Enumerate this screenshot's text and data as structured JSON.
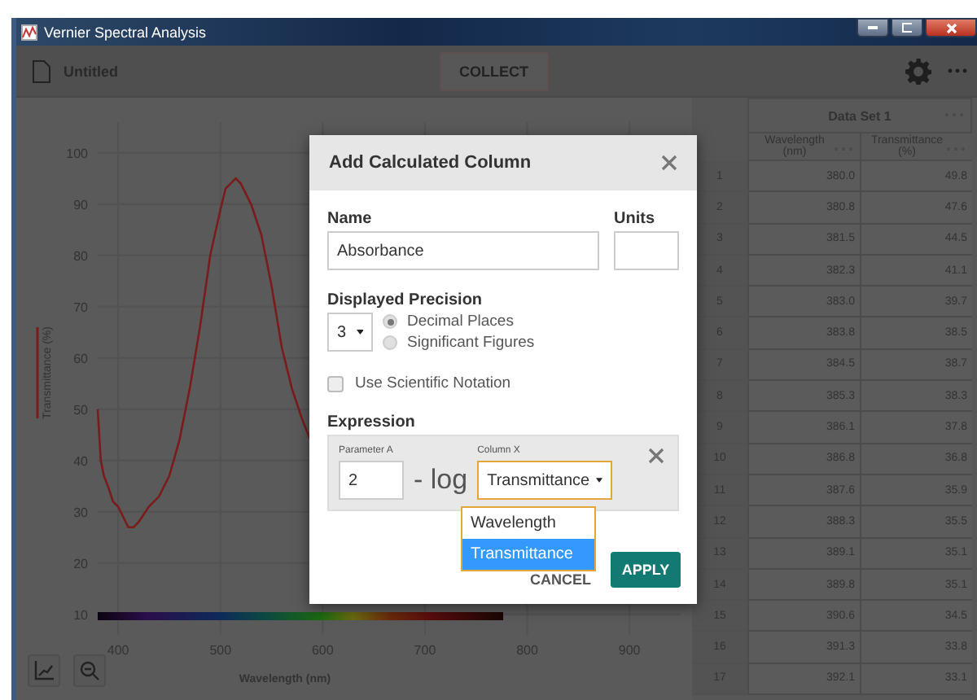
{
  "window": {
    "title": "Vernier Spectral Analysis"
  },
  "toolbar": {
    "document": "Untitled",
    "collect_button": {
      "label": "COLLECT",
      "disabled": true
    }
  },
  "graph": {
    "chart_data": {
      "type": "line",
      "xlabel": "Wavelength (nm)",
      "ylabel": "Transmittance (%)",
      "xlim": [
        380,
        950
      ],
      "ylim": [
        6,
        106
      ],
      "xticks": [
        400,
        500,
        600,
        700,
        800,
        900
      ],
      "yticks": [
        10,
        20,
        30,
        40,
        50,
        60,
        70,
        80,
        90,
        100
      ],
      "grid": true,
      "x": [
        380,
        383,
        386,
        390,
        395,
        400,
        405,
        410,
        415,
        420,
        430,
        440,
        450,
        460,
        470,
        480,
        490,
        500,
        505,
        510,
        515,
        520,
        530,
        540,
        550,
        560,
        570,
        580,
        590
      ],
      "series": [
        {
          "color": "#7a1c1c",
          "values": [
            50,
            40,
            37,
            35,
            32,
            31,
            29,
            27,
            27,
            28,
            31,
            33,
            37,
            44,
            54,
            66,
            80,
            89,
            93,
            94,
            95,
            94,
            90,
            84,
            74,
            62,
            54,
            48,
            43
          ]
        }
      ]
    }
  },
  "table": {
    "group": "Data Set 1",
    "columns": [
      "Wavelength (nm)",
      "Transmittance (%)"
    ],
    "rows": [
      {
        "index": "1",
        "cells": [
          "380.0",
          "49.8"
        ]
      },
      {
        "index": "2",
        "cells": [
          "380.8",
          "47.6"
        ]
      },
      {
        "index": "3",
        "cells": [
          "381.5",
          "44.5"
        ]
      },
      {
        "index": "4",
        "cells": [
          "382.3",
          "41.1"
        ]
      },
      {
        "index": "5",
        "cells": [
          "383.0",
          "39.7"
        ]
      },
      {
        "index": "6",
        "cells": [
          "383.8",
          "38.5"
        ]
      },
      {
        "index": "7",
        "cells": [
          "384.5",
          "38.7"
        ]
      },
      {
        "index": "8",
        "cells": [
          "385.3",
          "38.3"
        ]
      },
      {
        "index": "9",
        "cells": [
          "386.1",
          "37.8"
        ]
      },
      {
        "index": "10",
        "cells": [
          "386.8",
          "36.8"
        ]
      },
      {
        "index": "11",
        "cells": [
          "387.6",
          "35.9"
        ]
      },
      {
        "index": "12",
        "cells": [
          "388.3",
          "35.5"
        ]
      },
      {
        "index": "13",
        "cells": [
          "389.1",
          "35.1"
        ]
      },
      {
        "index": "14",
        "cells": [
          "389.8",
          "35.1"
        ]
      },
      {
        "index": "15",
        "cells": [
          "390.6",
          "34.5"
        ]
      },
      {
        "index": "16",
        "cells": [
          "391.3",
          "33.8"
        ]
      },
      {
        "index": "17",
        "cells": [
          "392.1",
          "33.1"
        ]
      }
    ]
  },
  "dialog": {
    "title": "Add Calculated Column",
    "name_label": "Name",
    "name_value": "Absorbance",
    "units_label": "Units",
    "precision_label": "Displayed Precision",
    "precision_value": "3",
    "precision_modes": [
      {
        "label": "Decimal Places",
        "selected": true
      },
      {
        "label": "Significant Figures",
        "selected": false
      }
    ],
    "scientific_notation": {
      "label": "Use Scientific Notation",
      "checked": false
    },
    "expression_label": "Expression",
    "parameter_label": "Parameter A",
    "parameter_value": "2",
    "operator": "- log",
    "column_label": "Column X",
    "column_value": "Transmittance",
    "column_options": [
      {
        "label": "Wavelength",
        "selected": false
      },
      {
        "label": "Transmittance",
        "selected": true
      }
    ],
    "buttons": [
      {
        "label": "CANCEL",
        "kind": "flat"
      },
      {
        "label": "APPLY",
        "kind": "primary"
      }
    ]
  }
}
